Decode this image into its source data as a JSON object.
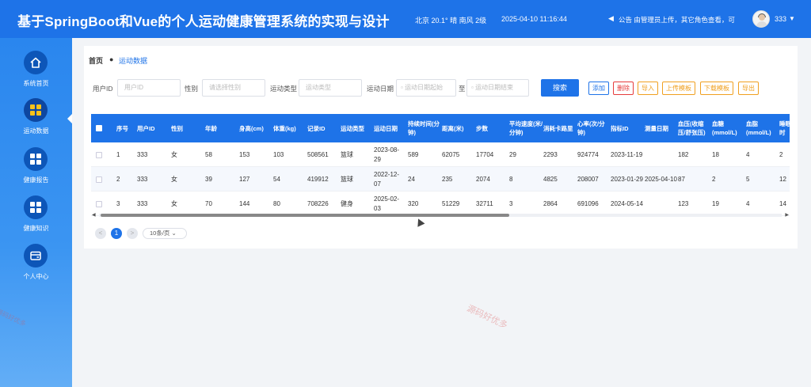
{
  "header": {
    "title": "基于SpringBoot和Vue的个人运动健康管理系统的实现与设计",
    "weather": "北京 20.1° 晴 南风 2级",
    "datetime": "2025-04-10 11:16:44",
    "notice_icon": "◀",
    "notice": "公告 由管理员上传，其它角色查看，可",
    "username": "333",
    "caret": "▼"
  },
  "sidebar": {
    "items": [
      {
        "label": "系统首页",
        "icon": "home-icon"
      },
      {
        "label": "运动数据",
        "icon": "grid-icon"
      },
      {
        "label": "健康报告",
        "icon": "grid-icon"
      },
      {
        "label": "健康知识",
        "icon": "grid-icon"
      },
      {
        "label": "个人中心",
        "icon": "wallet-icon"
      }
    ],
    "active_index": 1
  },
  "breadcrumb": {
    "home": "首页",
    "separator": "●",
    "current": "运动数据"
  },
  "search": {
    "user_id_label": "用户ID",
    "user_id_placeholder": "用户ID",
    "gender_label": "性别",
    "gender_placeholder": "请选择性别",
    "sport_type_label": "运动类型",
    "sport_type_placeholder": "运动类型",
    "sport_date_label": "运动日期",
    "date_start_placeholder": "运动日期起始",
    "date_to": "至",
    "date_end_placeholder": "运动日期结束",
    "search_button": "搜索"
  },
  "actions": {
    "add": "添加",
    "delete": "删除",
    "import": "导入",
    "upload_template": "上传模板",
    "download_template": "下载模板",
    "export": "导出"
  },
  "table": {
    "columns": [
      "序号",
      "用户ID",
      "性别",
      "年龄",
      "身高(cm)",
      "体重(kg)",
      "记录ID",
      "运动类型",
      "运动日期",
      "持续时间(分钟)",
      "距离(米)",
      "步数",
      "平均速度(米/分钟)",
      "消耗卡路里",
      "心率(次/分钟)",
      "指标ID",
      "测量日期",
      "血压(收缩压/舒张压)",
      "血糖(mmol/L)",
      "血脂(mmol/L)",
      "睡眠时"
    ],
    "rows": [
      [
        "1",
        "333",
        "女",
        "58",
        "153",
        "103",
        "508561",
        "篮球",
        "2023-08-29",
        "589",
        "62075",
        "17704",
        "29",
        "2293",
        "924774",
        "2023-11-19",
        "",
        "182",
        "18",
        "4",
        "2"
      ],
      [
        "2",
        "333",
        "女",
        "39",
        "127",
        "54",
        "419912",
        "篮球",
        "2022-12-07",
        "24",
        "235",
        "2074",
        "8",
        "4825",
        "208007",
        "2023-01-29",
        "2025-04-10",
        "87",
        "2",
        "5",
        "12"
      ],
      [
        "3",
        "333",
        "女",
        "70",
        "144",
        "80",
        "708226",
        "健身",
        "2025-02-03",
        "320",
        "51229",
        "32711",
        "3",
        "2864",
        "691096",
        "2024-05-14",
        "",
        "123",
        "19",
        "4",
        "14"
      ]
    ]
  },
  "pagination": {
    "prev": "<",
    "current_page": "1",
    "next": ">",
    "page_size": "10条/页"
  },
  "watermarks": [
    "源码好优多",
    "源码好优多"
  ],
  "colors": {
    "primary": "#1e73e8",
    "delete": "#e63b3b",
    "orange": "#f0a020"
  }
}
